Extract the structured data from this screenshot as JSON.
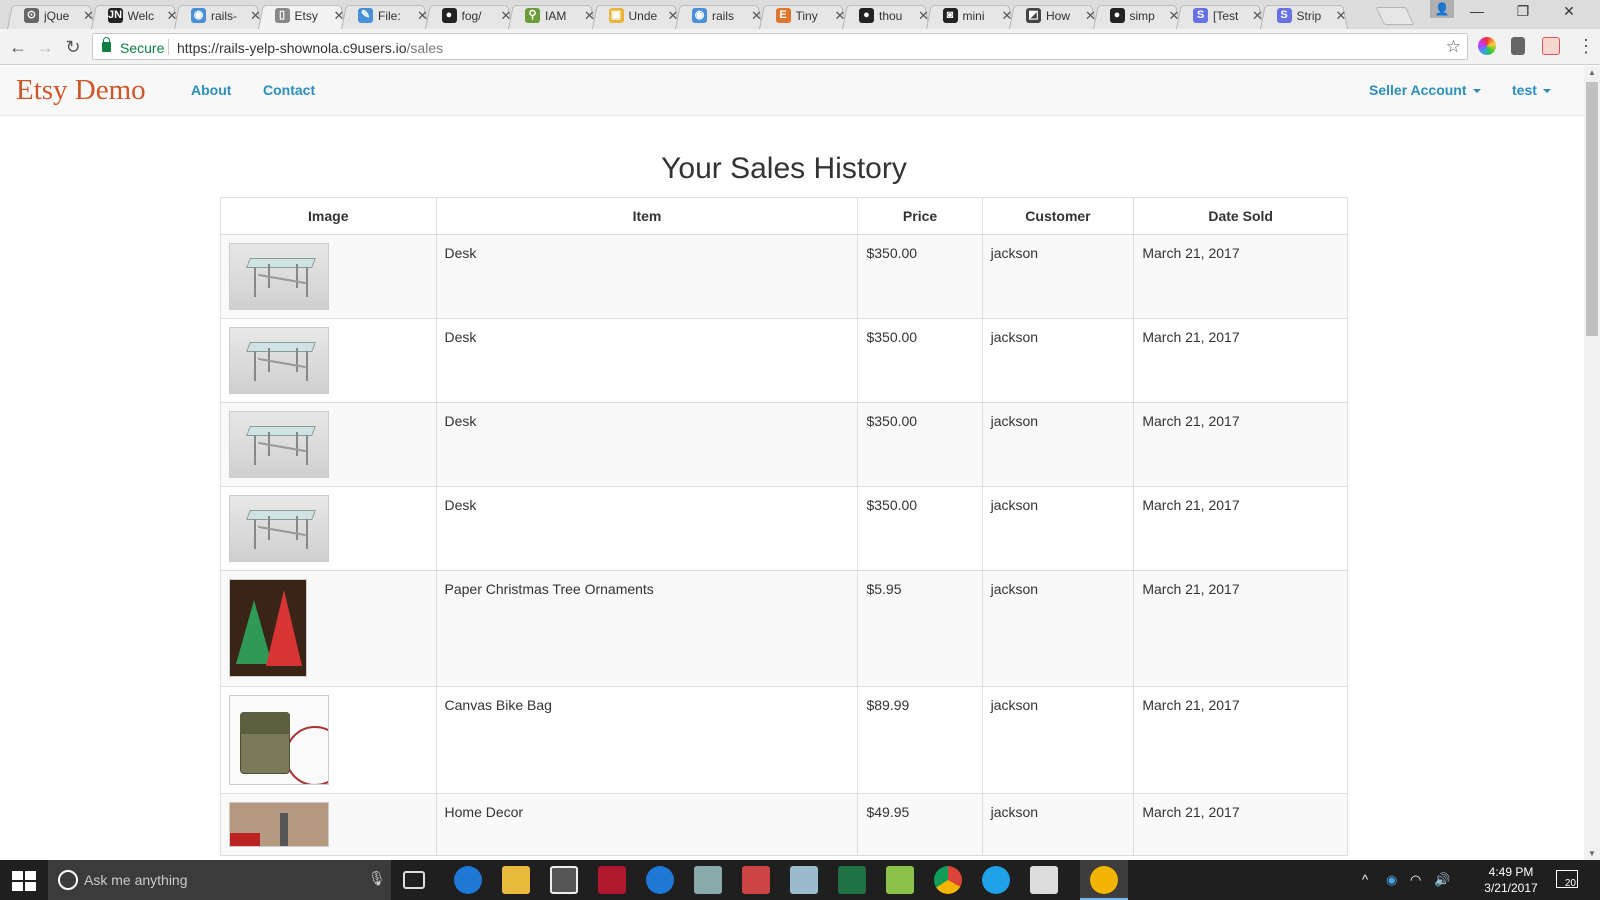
{
  "browser": {
    "tabs": [
      {
        "title": "jQue",
        "favicon_color": "#666666",
        "glyph": "⊙"
      },
      {
        "title": "Welc",
        "favicon_color": "#222222",
        "glyph": "JN"
      },
      {
        "title": "rails-",
        "favicon_color": "#4a90d9",
        "glyph": "◉"
      },
      {
        "title": "Etsy",
        "favicon_color": "#888888",
        "glyph": "▯"
      },
      {
        "title": "File:",
        "favicon_color": "#4a90d9",
        "glyph": "✎"
      },
      {
        "title": "fog/",
        "favicon_color": "#222222",
        "glyph": "●"
      },
      {
        "title": "IAM",
        "favicon_color": "#6b9e3a",
        "glyph": "⚲"
      },
      {
        "title": "Unde",
        "favicon_color": "#e8b53a",
        "glyph": "▣"
      },
      {
        "title": "rails",
        "favicon_color": "#4a90d9",
        "glyph": "◉"
      },
      {
        "title": "Tiny",
        "favicon_color": "#e0762d",
        "glyph": "E"
      },
      {
        "title": "thou",
        "favicon_color": "#222222",
        "glyph": "●"
      },
      {
        "title": "mini",
        "favicon_color": "#222222",
        "glyph": "◙"
      },
      {
        "title": "How",
        "favicon_color": "#444444",
        "glyph": "◩"
      },
      {
        "title": "simp",
        "favicon_color": "#222222",
        "glyph": "●"
      },
      {
        "title": "[Test",
        "favicon_color": "#6772e5",
        "glyph": "S"
      },
      {
        "title": "Strip",
        "favicon_color": "#6772e5",
        "glyph": "S"
      }
    ],
    "active_tab_index": 3,
    "secure_label": "Secure",
    "url_host": "https://rails-yelp-shownola.c9users.io",
    "url_path": "/sales"
  },
  "navbar": {
    "brand": "Etsy Demo",
    "about": "About",
    "contact": "Contact",
    "seller_account": "Seller Account",
    "user": "test"
  },
  "page_title": "Your Sales History",
  "table": {
    "headers": [
      "Image",
      "Item",
      "Price",
      "Customer",
      "Date Sold"
    ],
    "rows": [
      {
        "image": "desk",
        "item": "Desk",
        "price": "$350.00",
        "customer": "jackson",
        "date": "March 21, 2017"
      },
      {
        "image": "desk",
        "item": "Desk",
        "price": "$350.00",
        "customer": "jackson",
        "date": "March 21, 2017"
      },
      {
        "image": "desk",
        "item": "Desk",
        "price": "$350.00",
        "customer": "jackson",
        "date": "March 21, 2017"
      },
      {
        "image": "desk",
        "item": "Desk",
        "price": "$350.00",
        "customer": "jackson",
        "date": "March 21, 2017"
      },
      {
        "image": "tree",
        "item": "Paper Christmas Tree Ornaments",
        "price": "$5.95",
        "customer": "jackson",
        "date": "March 21, 2017"
      },
      {
        "image": "bag",
        "item": "Canvas Bike Bag",
        "price": "$89.99",
        "customer": "jackson",
        "date": "March 21, 2017"
      },
      {
        "image": "decor",
        "item": "Home Decor",
        "price": "$49.95",
        "customer": "jackson",
        "date": "March 21, 2017"
      }
    ]
  },
  "taskbar": {
    "search_placeholder": "Ask me anything",
    "time": "4:49 PM",
    "date": "3/21/2017",
    "notification_count": "20"
  },
  "colors": {
    "brand": "#d0562a",
    "link": "#2a8fbd",
    "secure": "#0b8043"
  }
}
